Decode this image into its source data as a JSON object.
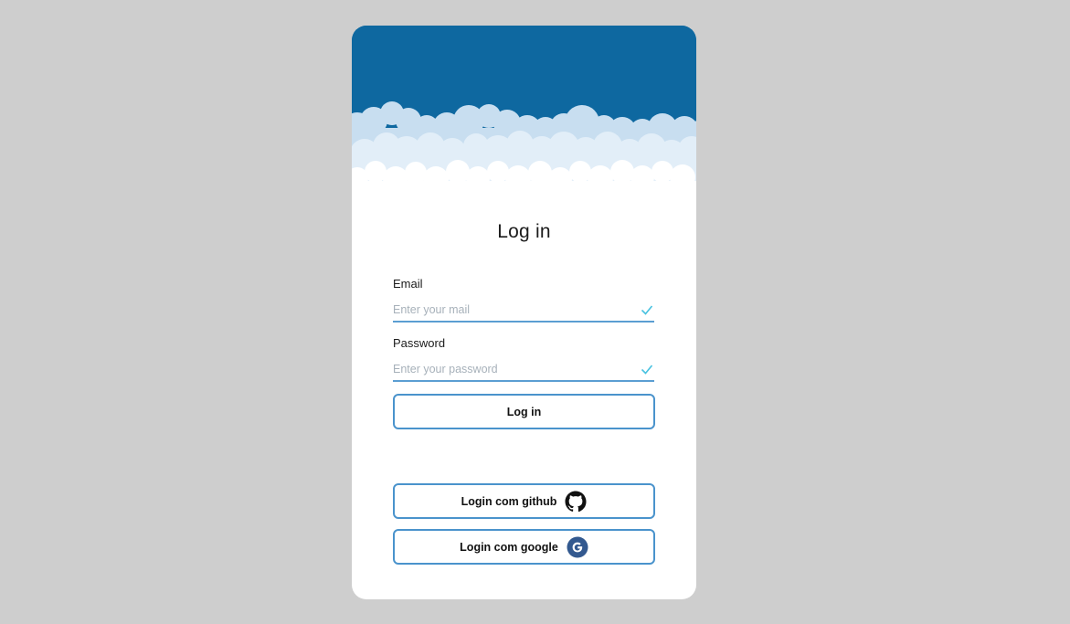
{
  "login": {
    "title": "Log in",
    "email": {
      "label": "Email",
      "placeholder": "Enter your mail",
      "value": ""
    },
    "password": {
      "label": "Password",
      "placeholder": "Enter your password",
      "value": ""
    },
    "submit_label": "Log in"
  },
  "social": {
    "github_label": "Login com github",
    "google_label": "Login com google"
  },
  "icons": {
    "hero": "clouds-banner",
    "email_status": "check-icon",
    "password_status": "check-icon",
    "github": "github-icon",
    "google": "google-icon"
  },
  "colors": {
    "page_background": "#cecece",
    "hero_sky": "#0e68a0",
    "accent": "#4a93cc",
    "check": "#49c2e0",
    "google_badge": "#33598f"
  }
}
